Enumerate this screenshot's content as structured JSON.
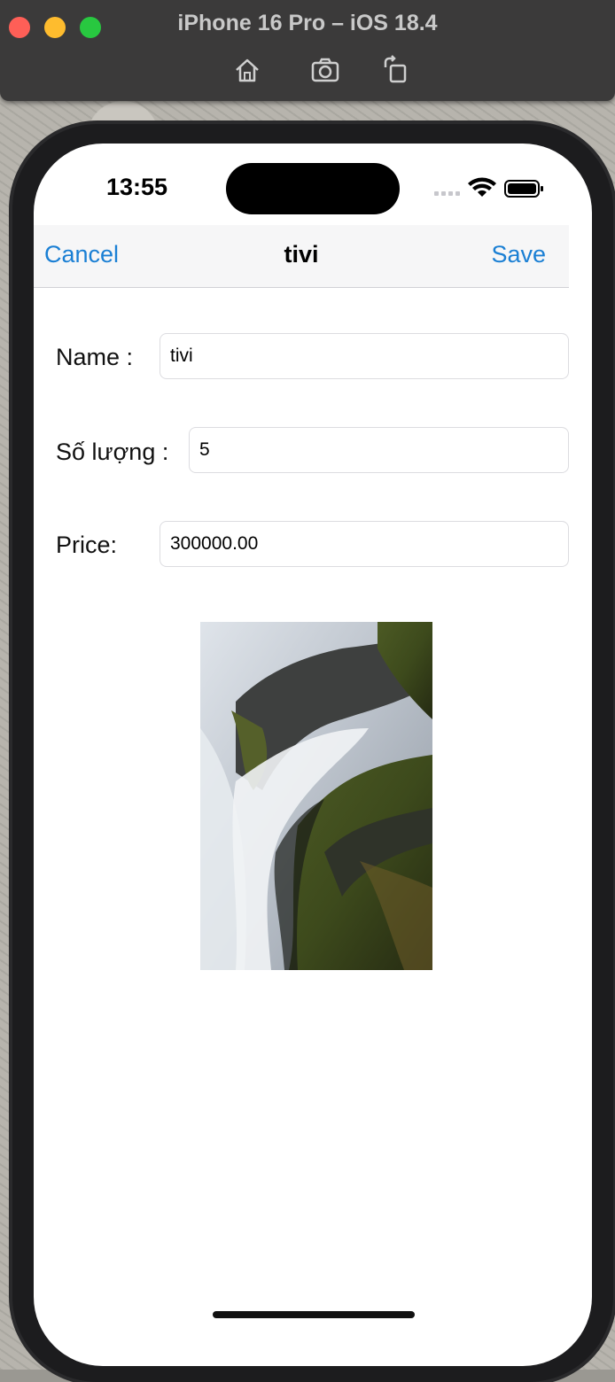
{
  "window": {
    "title": "iPhone 16 Pro – iOS 18.4",
    "toolbar_icons": [
      "home-icon",
      "screenshot-icon",
      "rotate-icon"
    ]
  },
  "status_bar": {
    "time": "13:55",
    "icons": [
      "cellular-icon",
      "wifi-icon",
      "battery-icon"
    ]
  },
  "nav": {
    "cancel_label": "Cancel",
    "title": "tivi",
    "save_label": "Save",
    "accent_color": "#1a7fd4"
  },
  "form": {
    "name": {
      "label": "Name :",
      "value": "tivi"
    },
    "quantity": {
      "label": "Số lượng :",
      "value": "5"
    },
    "price": {
      "label": "Price:",
      "value": "300000.00"
    }
  },
  "image": {
    "subject": "waterfall-over-mossy-rocks"
  }
}
